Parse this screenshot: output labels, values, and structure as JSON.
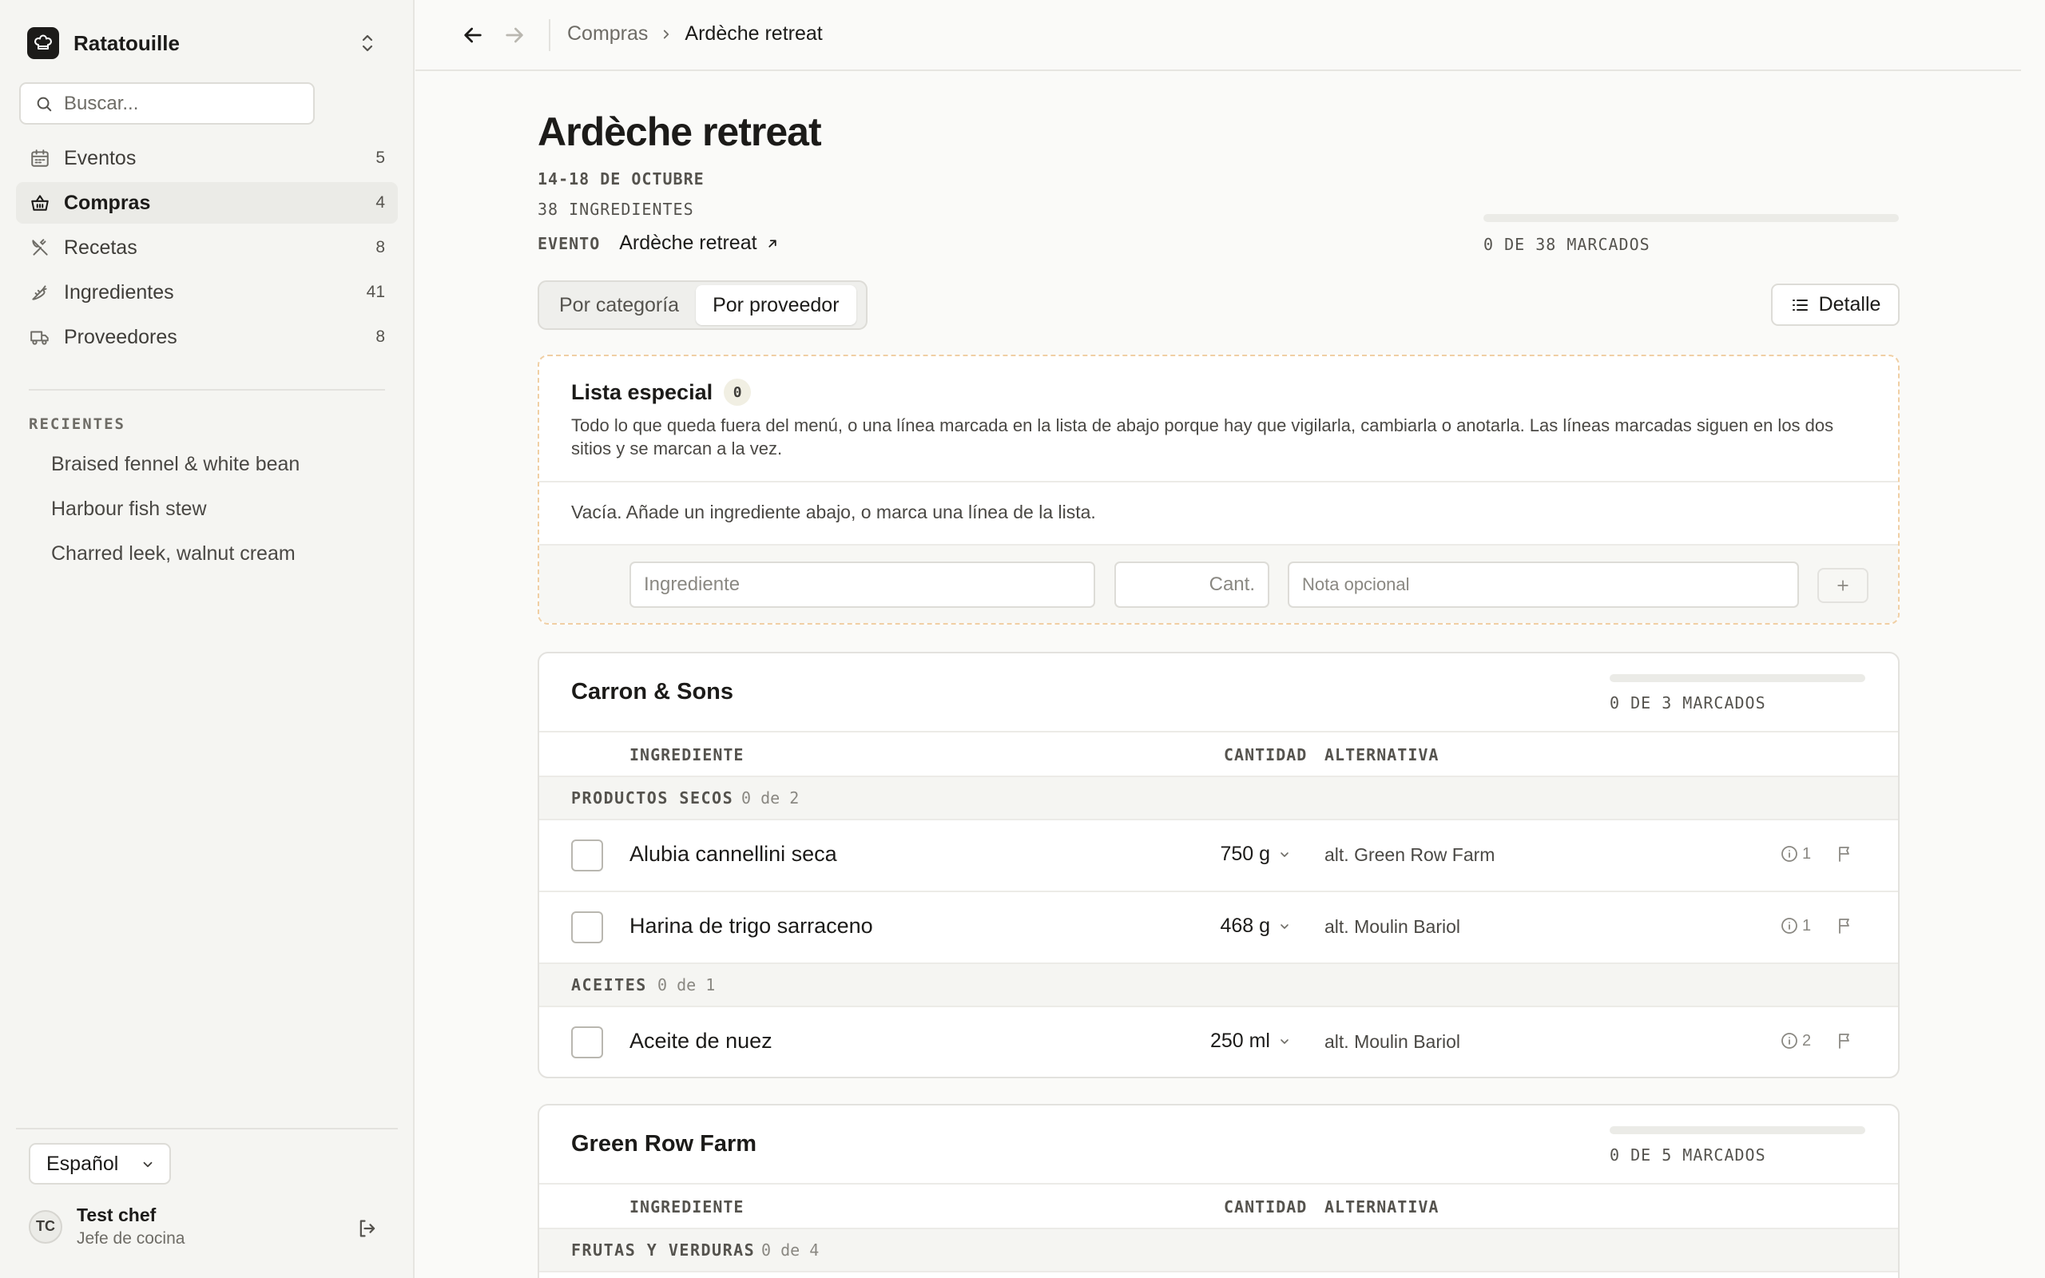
{
  "app": {
    "name": "Ratatouille"
  },
  "sidebar": {
    "search_placeholder": "Buscar...",
    "items": [
      {
        "label": "Eventos",
        "count": "5"
      },
      {
        "label": "Compras",
        "count": "4"
      },
      {
        "label": "Recetas",
        "count": "8"
      },
      {
        "label": "Ingredientes",
        "count": "41"
      },
      {
        "label": "Proveedores",
        "count": "8"
      }
    ],
    "recent_heading": "RECIENTES",
    "recent": [
      "Braised fennel & white bean",
      "Harbour fish stew",
      "Charred leek, walnut cream"
    ],
    "language": "Español",
    "user": {
      "initials": "TC",
      "name": "Test chef",
      "role": "Jefe de cocina"
    }
  },
  "breadcrumb": {
    "parent": "Compras",
    "current": "Ardèche retreat"
  },
  "page": {
    "title": "Ardèche retreat",
    "dates": "14-18 DE OCTUBRE",
    "ingredients": "38 INGREDIENTES",
    "event_label": "EVENTO",
    "event_link": "Ardèche retreat",
    "progress_label": "0 DE 38 MARCADOS",
    "progress_fraction": 0
  },
  "view_toggle": {
    "by_category": "Por categoría",
    "by_supplier": "Por proveedor",
    "selected": "Por proveedor"
  },
  "detail_button": "Detalle",
  "special_list": {
    "title": "Lista especial",
    "count": "0",
    "description": "Todo lo que queda fuera del menú, o una línea marcada en la lista de abajo porque hay que vigilarla, cambiarla o anotarla. Las líneas marcadas siguen en los dos sitios y se marcan a la vez.",
    "empty_text": "Vacía. Añade un ingrediente abajo, o marca una línea de la lista.",
    "ingredient_placeholder": "Ingrediente",
    "quantity_placeholder": "Cant.",
    "note_placeholder": "Nota opcional",
    "add_label": "+"
  },
  "columns": {
    "ingredient": "INGREDIENTE",
    "quantity": "CANTIDAD",
    "alternative": "ALTERNATIVA"
  },
  "suppliers": [
    {
      "name": "Carron & Sons",
      "progress_label": "0 DE 3 MARCADOS",
      "progress_fraction": 0,
      "groups": [
        {
          "name": "PRODUCTOS SECOS",
          "count": "0 de 2",
          "rows": [
            {
              "name": "Alubia cannellini seca",
              "qty": "750 g",
              "alt": "alt. Green Row Farm",
              "info": "1"
            },
            {
              "name": "Harina de trigo sarraceno",
              "qty": "468 g",
              "alt": "alt. Moulin Bariol",
              "info": "1"
            }
          ]
        },
        {
          "name": "ACEITES",
          "count": "0 de 1",
          "rows": [
            {
              "name": "Aceite de nuez",
              "qty": "250 ml",
              "alt": "alt. Moulin Bariol",
              "info": "2"
            }
          ]
        }
      ]
    },
    {
      "name": "Green Row Farm",
      "progress_label": "0 DE 5 MARCADOS",
      "progress_fraction": 0,
      "groups": [
        {
          "name": "FRUTAS Y VERDURAS",
          "count": "0 de 4",
          "rows": []
        }
      ]
    }
  ]
}
